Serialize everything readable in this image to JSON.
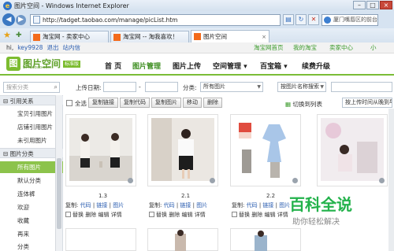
{
  "window": {
    "title": "图片空间 - Windows Internet Explorer",
    "url": "http://tadget.taobao.com/manage/picList.htm",
    "search_text": "厦门嘴唇区的前台乙"
  },
  "tabs": [
    {
      "label": "淘宝网 - 卖家中心"
    },
    {
      "label": "淘宝网 -- 淘我喜欢！"
    },
    {
      "label": "图片空间"
    }
  ],
  "sitebar": {
    "greeting": "hi,",
    "user": "key9928",
    "logout": "退出",
    "messages": "站内信",
    "taobao_home": "淘宝网首页",
    "my_taobao": "我的淘宝",
    "seller_center": "卖家中心",
    "more": "小"
  },
  "header": {
    "logo_text": "图片空间",
    "logo_sub": "tu.taobao.com",
    "badge": "标准版",
    "nav": [
      "首 页",
      "图片管理",
      "图片上传",
      "空间管理",
      "百宝箱",
      "续费升级"
    ]
  },
  "filters": {
    "search_placeholder": "搜索分类",
    "upload_date_label": "上传日期:",
    "category_label": "分类:",
    "category_value": "所有图片",
    "name_search_value": "按图片名称搜索",
    "view_switch": "切换到列表",
    "sort_value": "按上传时间从晚到早"
  },
  "actions": {
    "select_all": "全选",
    "buttons": [
      "复制链接",
      "复制代码",
      "复制图片",
      "移动",
      "删除"
    ]
  },
  "sidebar": {
    "sections": [
      {
        "label": "引用关系",
        "items": [
          "宝贝引用图片",
          "店铺引用图片",
          "未引用图片"
        ]
      },
      {
        "label": "图片分类",
        "items": [
          "所有图片",
          "默认分类",
          "连体裤",
          "欢迎",
          "收藏",
          "再来",
          "分类"
        ]
      }
    ]
  },
  "cards": [
    {
      "dim": "1.3",
      "copy": "复制:",
      "links": [
        "代码",
        "链接",
        "图片"
      ],
      "ops": [
        "替换",
        "删除",
        "编辑",
        "详情"
      ]
    },
    {
      "dim": "2.1",
      "copy": "复制:",
      "links": [
        "代码",
        "链接",
        "图片"
      ],
      "ops": [
        "替换",
        "删除",
        "编辑",
        "详情"
      ]
    },
    {
      "dim": "2.2",
      "copy": "复制:",
      "links": [
        "代码",
        "链接",
        "图片"
      ],
      "ops": [
        "替换",
        "删除",
        "编辑",
        "详情"
      ]
    },
    {
      "dim": "",
      "copy": "",
      "links": [],
      "ops": []
    }
  ],
  "watermark": {
    "title": "百科全说",
    "subtitle": "助你轻松解决"
  }
}
